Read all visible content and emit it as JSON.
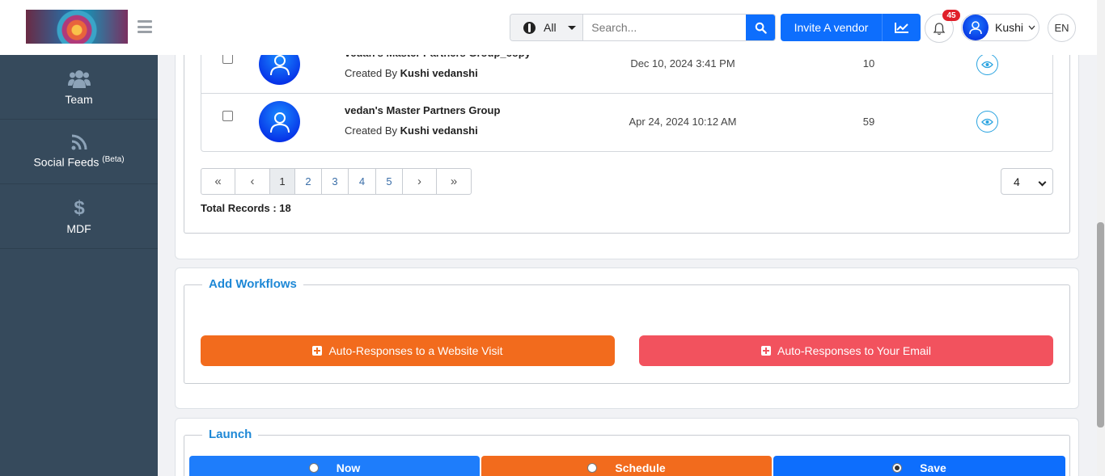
{
  "header": {
    "filter_label": "All",
    "search_placeholder": "Search...",
    "invite_label": "Invite A vendor",
    "notification_count": "45",
    "user_name": "Kushi",
    "language": "EN"
  },
  "sidebar": {
    "items": [
      {
        "label": "Team",
        "sup": ""
      },
      {
        "label": "Social Feeds ",
        "sup": "(Beta)"
      },
      {
        "label": "MDF",
        "sup": ""
      }
    ]
  },
  "table": {
    "rows": [
      {
        "name": "vedan's Master Partners Group_copy",
        "created_prefix": "Created By ",
        "created_by": "Kushi vedanshi",
        "date": "Dec 10, 2024 3:41 PM",
        "count": "10"
      },
      {
        "name": "vedan's Master Partners Group",
        "created_prefix": "Created By ",
        "created_by": "Kushi vedanshi",
        "date": "Apr 24, 2024 10:12 AM",
        "count": "59"
      }
    ]
  },
  "pagination": {
    "first": "«",
    "prev": "‹",
    "pages": [
      "1",
      "2",
      "3",
      "4",
      "5"
    ],
    "next": "›",
    "last": "»",
    "per_page": "4",
    "total_records": "Total Records : 18"
  },
  "workflows": {
    "title": "Add Workflows",
    "website_visit_label": "Auto-Responses to a Website Visit",
    "email_label": "Auto-Responses to Your Email"
  },
  "launch": {
    "title": "Launch",
    "now_label": "Now",
    "schedule_label": "Schedule",
    "save_label": "Save"
  },
  "colors": {
    "primary": "#0d6efd",
    "sidebar": "#364a5c",
    "orange": "#f26b1d",
    "red": "#f2525e",
    "legend": "#1e88d6"
  }
}
